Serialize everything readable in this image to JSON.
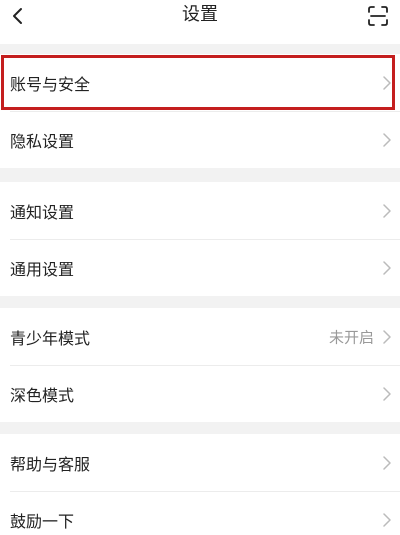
{
  "header": {
    "title": "设置",
    "back_icon": "chevron-left-icon",
    "scan_icon": "scan-icon"
  },
  "groups": [
    {
      "items": [
        {
          "label": "账号与安全",
          "highlighted": true
        },
        {
          "label": "隐私设置"
        }
      ]
    },
    {
      "items": [
        {
          "label": "通知设置"
        },
        {
          "label": "通用设置"
        }
      ]
    },
    {
      "items": [
        {
          "label": "青少年模式",
          "value": "未开启"
        },
        {
          "label": "深色模式"
        }
      ]
    },
    {
      "items": [
        {
          "label": "帮助与客服"
        },
        {
          "label": "鼓励一下"
        }
      ]
    }
  ],
  "colors": {
    "highlight": "#c41e1e",
    "background": "#f2f2f2",
    "chevron": "#bbbbbb",
    "value_text": "#999999"
  }
}
